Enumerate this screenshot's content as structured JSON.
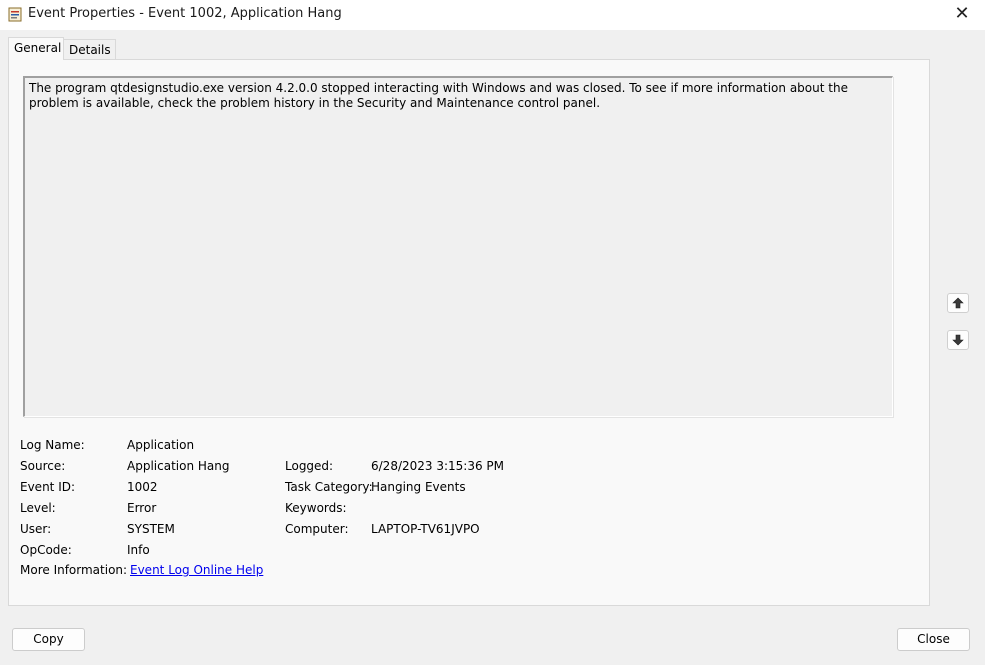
{
  "window": {
    "title": "Event Properties - Event 1002, Application Hang",
    "close_glyph": "✕"
  },
  "tabs": [
    {
      "label": "General",
      "active": true
    },
    {
      "label": "Details",
      "active": false
    }
  ],
  "description": "The program qtdesignstudio.exe version 4.2.0.0 stopped interacting with Windows and was closed. To see if more information about the problem is available, check the problem history in the Security and Maintenance control panel.",
  "fields": {
    "log_name": {
      "label": "Log Name:",
      "value": "Application"
    },
    "source": {
      "label": "Source:",
      "value": "Application Hang"
    },
    "event_id": {
      "label": "Event ID:",
      "value": "1002"
    },
    "level": {
      "label": "Level:",
      "value": "Error"
    },
    "user": {
      "label": "User:",
      "value": "SYSTEM"
    },
    "opcode": {
      "label": "OpCode:",
      "value": "Info"
    },
    "more_info": {
      "label": "More Information:",
      "value": "Event Log Online Help"
    },
    "logged": {
      "label": "Logged:",
      "value": "6/28/2023 3:15:36 PM"
    },
    "task_category": {
      "label": "Task Category:",
      "value": "Hanging Events"
    },
    "keywords": {
      "label": "Keywords:",
      "value": ""
    },
    "computer": {
      "label": "Computer:",
      "value": "LAPTOP-TV61JVPO"
    }
  },
  "icons": {
    "up": "arrow-up-icon",
    "down": "arrow-down-icon",
    "app": "event-viewer-icon"
  },
  "buttons": {
    "copy": "Copy",
    "close": "Close"
  },
  "colors": {
    "link": "#0000ee",
    "window_bg": "#f0f0f0"
  }
}
